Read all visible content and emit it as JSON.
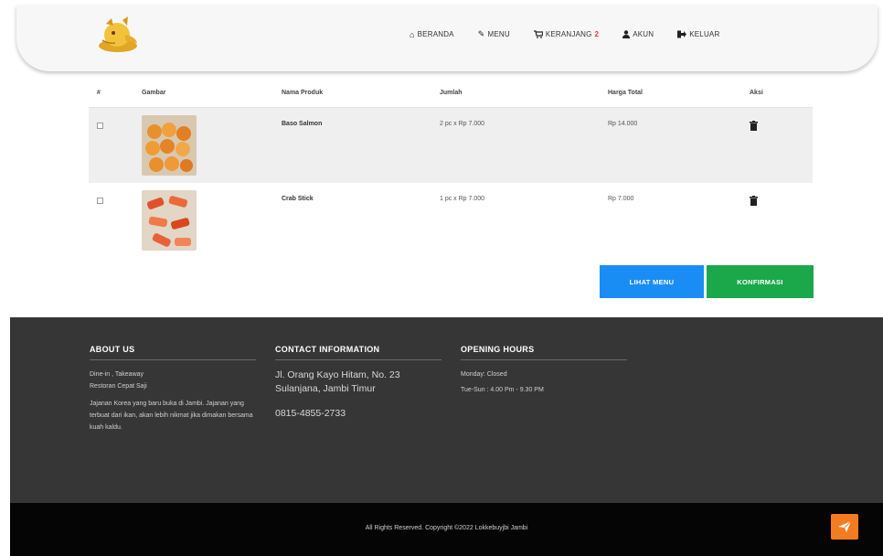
{
  "header": {
    "nav": [
      {
        "icon": "home-icon",
        "label": "BERANDA"
      },
      {
        "icon": "pencil-icon",
        "label": "MENU"
      },
      {
        "icon": "cart-icon",
        "label": "KERANJANG"
      },
      {
        "icon": "user-icon",
        "label": "AKUN"
      },
      {
        "icon": "sign-out-icon",
        "label": "KELUAR"
      }
    ],
    "cart_count": "2"
  },
  "table": {
    "headers": [
      "#",
      "Gambar",
      "Nama Produk",
      "Jumlah",
      "Harga Total",
      "Aksi"
    ],
    "rows": [
      {
        "name": "Baso Salmon",
        "qty": "2 pc x Rp 7.000",
        "total": "Rp 14.000"
      },
      {
        "name": "Crab Stick",
        "qty": "1 pc x Rp 7.000",
        "total": "Rp 7.000"
      }
    ]
  },
  "buttons": {
    "view_menu": "LIHAT MENU",
    "confirm": "KONFIRMASI"
  },
  "footer": {
    "about": {
      "title": "ABOUT US",
      "line1": "Dine-in , Takeaway",
      "line2": "Restoran Cepat Saji",
      "desc": "Jajanan Korea yang baru buka di Jambi. Jajanan yang terbuat dari ikan, akan lebih nikmat jika dimakan bersama kuah kaldu."
    },
    "contact": {
      "title": "CONTACT INFORMATION",
      "address1": "Jl. Orang Kayo Hitam, No. 23",
      "address2": "Sulanjana, Jambi Timur",
      "phone": "0815-4855-2733"
    },
    "hours": {
      "title": "OPENING HOURS",
      "line1": "Monday: Closed",
      "line2": "Tue-Sun : 4.00 Pm - 9.30 PM"
    }
  },
  "copyright": "All Rights Reserved. Copyright ©2022 Lokkebuyjbi Jambi",
  "colors": {
    "primary_button": "#1a8df5",
    "confirm_button": "#1aa84b",
    "footer_bg": "#363636",
    "back_to_top": "#f47c20"
  }
}
